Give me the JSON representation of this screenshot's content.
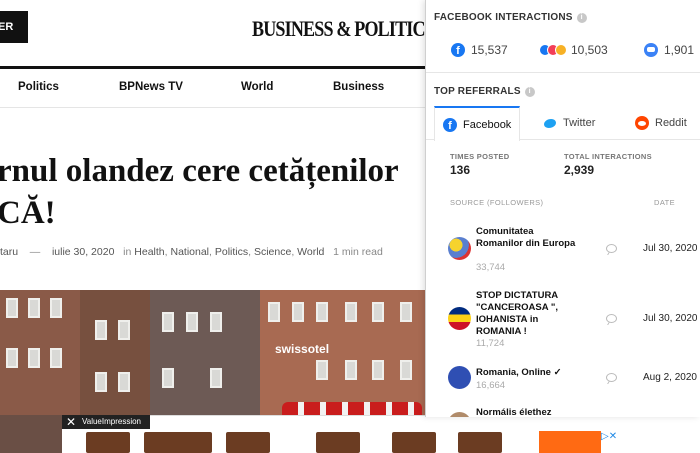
{
  "site": {
    "subscribe_label": "ER",
    "logo": "BUSINESS & POLITICS NEWS",
    "nav": [
      "Politics",
      "BPNews TV",
      "World",
      "Business"
    ],
    "headline_line1": "rnul olandez cere cetățenilor",
    "headline_line2": "CĂ!",
    "meta": {
      "author": "taru",
      "separator": "—",
      "date": "iulie 30, 2020",
      "in_label": "in",
      "categories": [
        "Health",
        "National",
        "Politics",
        "Science",
        "World"
      ],
      "read_time": "1 min read"
    },
    "photo_sign": "swissotel"
  },
  "ad": {
    "close": "✕",
    "brand": "ValueImpression"
  },
  "panel": {
    "facebook_interactions": {
      "title": "FACEBOOK INTERACTIONS",
      "counts": [
        {
          "icon": "facebook-icon",
          "value": "15,537"
        },
        {
          "icon": "reactions-icon",
          "value": "10,503"
        },
        {
          "icon": "comment-icon",
          "value": "1,901"
        }
      ]
    },
    "top_referrals": {
      "title": "TOP REFERRALS",
      "tabs": [
        "Facebook",
        "Twitter",
        "Reddit"
      ],
      "times_posted_label": "TIMES POSTED",
      "times_posted": "136",
      "total_interactions_label": "TOTAL INTERACTIONS",
      "total_interactions": "2,939",
      "col_source": "SOURCE (FOLLOWERS)",
      "col_date": "DATE",
      "rows": [
        {
          "name": "Comunitatea Romanilor din Europa",
          "followers": "33,744",
          "date": "Jul 30, 2020"
        },
        {
          "name": "STOP DICTATURA \"CANCEROASA \", IOHANISTA in ROMANIA !",
          "followers": "11,724",
          "date": "Jul 30, 2020"
        },
        {
          "name": "Romania, Online ✓",
          "followers": "16,664",
          "date": "Aug 2, 2020"
        },
        {
          "name": "Normális élethez",
          "followers": "",
          "date": ""
        }
      ]
    },
    "colors": {
      "facebook": "#1877f2",
      "twitter": "#1da1f2",
      "reddit": "#ff4500"
    }
  }
}
